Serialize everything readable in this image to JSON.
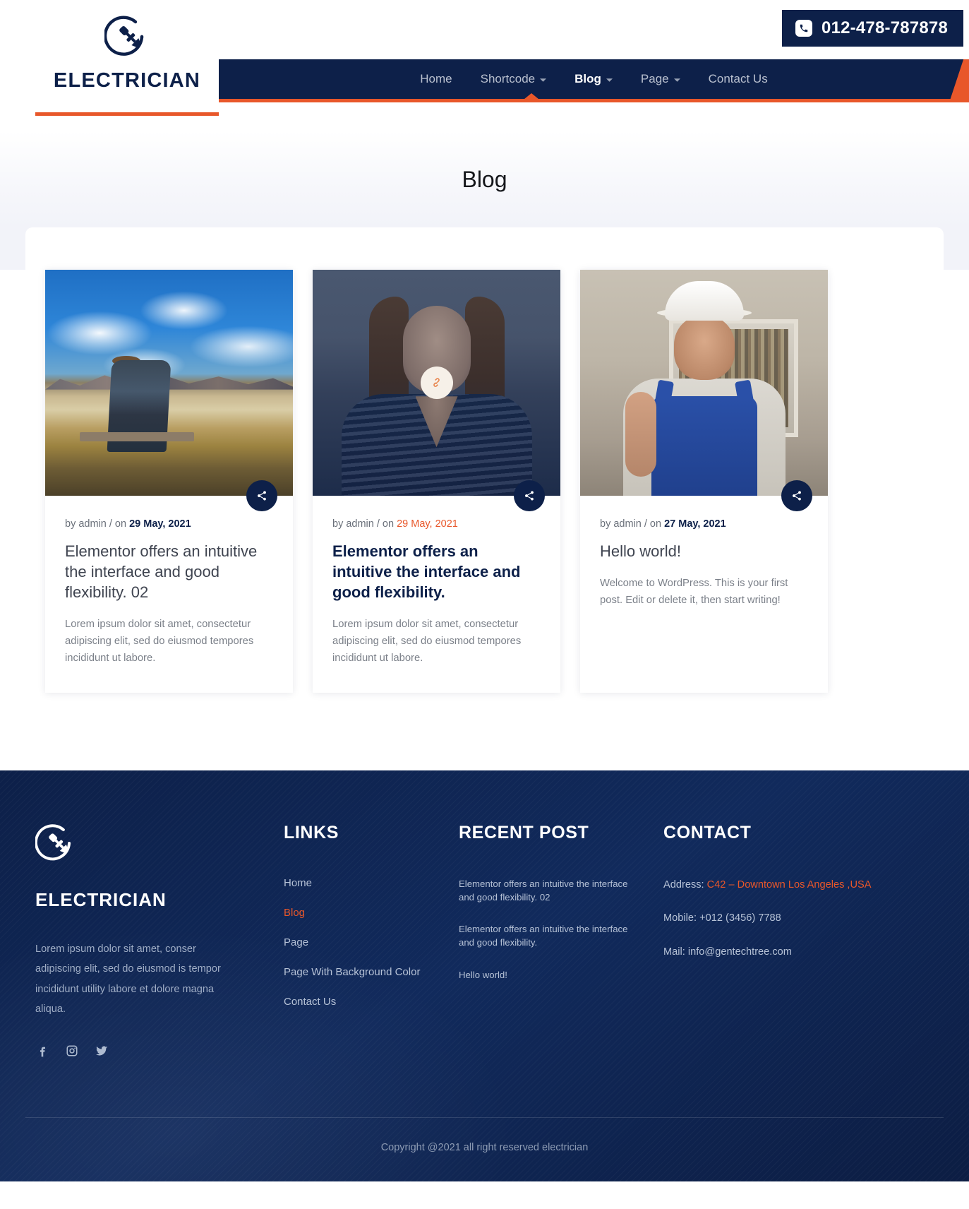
{
  "header": {
    "phone": "012-478-787878",
    "phone_icon": "phone-icon",
    "brand_name": "ELECTRICIAN",
    "logo_icon": "electric-plug-circle-logo",
    "nav": [
      {
        "label": "Home",
        "has_caret": false,
        "active": false
      },
      {
        "label": "Shortcode",
        "has_caret": true,
        "active": false
      },
      {
        "label": "Blog",
        "has_caret": true,
        "active": true
      },
      {
        "label": "Page",
        "has_caret": true,
        "active": false
      },
      {
        "label": "Contact Us",
        "has_caret": false,
        "active": false
      }
    ]
  },
  "banner": {
    "title": "Blog"
  },
  "blog": {
    "posts": [
      {
        "by": "by admin / on ",
        "date": "29 May, 2021",
        "date_accent": false,
        "title": "Elementor offers an intuitive the interface and good flexibility. 02",
        "title_highlight": false,
        "excerpt": "Lorem ipsum dolor sit amet, consectetur adipiscing elit, sed do eiusmod tempores incididunt ut labore.",
        "share_icon": "share-icon",
        "image_alt": "man-sitting-on-bench-landscape"
      },
      {
        "by": "by admin / on ",
        "date": "29 May, 2021",
        "date_accent": true,
        "title": "Elementor offers an intuitive the interface and good flexibility.",
        "title_highlight": true,
        "excerpt": "Lorem ipsum dolor sit amet, consectetur adipiscing elit, sed do eiusmod tempores incididunt ut labore.",
        "share_icon": "share-icon",
        "overlay_icon": "link-icon",
        "image_alt": "smiling-woman-portrait"
      },
      {
        "by": "by admin / on ",
        "date": "27 May, 2021",
        "date_accent": false,
        "title": "Hello world!",
        "title_highlight": false,
        "excerpt": "Welcome to WordPress. This is your first post. Edit or delete it, then start writing!",
        "share_icon": "share-icon",
        "image_alt": "electrician-with-white-helmet"
      }
    ]
  },
  "footer": {
    "logo_icon": "electric-plug-circle-logo",
    "brand_name": "ELECTRICIAN",
    "about": "Lorem ipsum dolor sit amet, conser adipiscing elit, sed do eiusmod is tempor incididunt utility labore et dolore magna aliqua.",
    "socials": [
      {
        "name": "facebook-icon"
      },
      {
        "name": "instagram-icon"
      },
      {
        "name": "twitter-icon"
      }
    ],
    "links_heading": "LINKS",
    "links": [
      {
        "label": "Home",
        "active": false
      },
      {
        "label": "Blog",
        "active": true
      },
      {
        "label": "Page",
        "active": false
      },
      {
        "label": "Page With Background Color",
        "active": false
      },
      {
        "label": "Contact Us",
        "active": false
      }
    ],
    "recent_heading": "RECENT POST",
    "recent": [
      {
        "title": "Elementor offers an intuitive the interface and good flexibility. 02"
      },
      {
        "title": "Elementor offers an intuitive the interface and good flexibility."
      },
      {
        "title": "Hello world!"
      }
    ],
    "contact_heading": "CONTACT",
    "contact": {
      "address_label": "Address: ",
      "address_value": "C42 – Downtown Los Angeles ,USA",
      "mobile": "Mobile: +012 (3456) 7788",
      "mail": "Mail: info@gentechtree.com"
    },
    "copyright": "Copyright @2021 all right reserved electrician"
  },
  "colors": {
    "navy": "#0d2049",
    "accent_orange": "#e8572a",
    "muted_text": "#7b8089"
  }
}
